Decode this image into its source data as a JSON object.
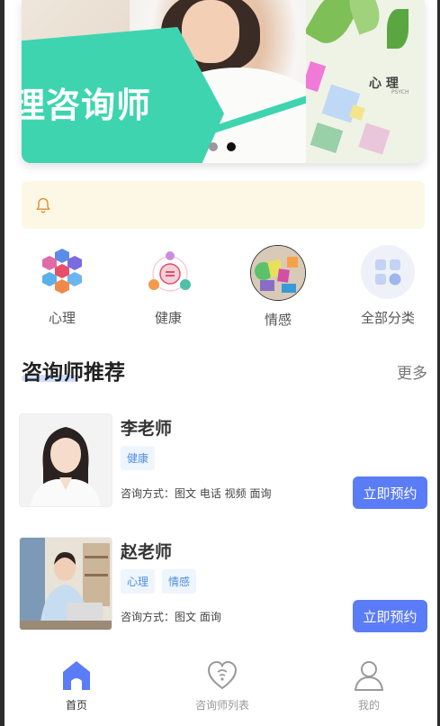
{
  "banner": {
    "slide1_caption": "理咨询师",
    "slide2_caption": "心 理",
    "slide2_sub": "PSYCH",
    "active_index": 1
  },
  "categories": [
    {
      "label": "心理",
      "icon": "psychology-hexagons-icon"
    },
    {
      "label": "健康",
      "icon": "health-diagram-icon"
    },
    {
      "label": "情感",
      "icon": "emotion-photo-icon"
    },
    {
      "label": "全部分类",
      "icon": "grid-apps-icon"
    }
  ],
  "section": {
    "title": "咨询师推荐",
    "more": "更多"
  },
  "counselors": [
    {
      "name": "李老师",
      "tags": [
        "健康"
      ],
      "method": "咨询方式：图文 电话 视频 面询",
      "button": "立即预约"
    },
    {
      "name": "赵老师",
      "tags": [
        "心理",
        "情感"
      ],
      "method": "咨询方式：图文 面询",
      "button": "立即预约"
    }
  ],
  "tabbar": {
    "items": [
      {
        "label": "首页",
        "icon": "home-icon",
        "active": true
      },
      {
        "label": "咨询师列表",
        "icon": "counselor-list-icon",
        "active": false
      },
      {
        "label": "我的",
        "icon": "user-icon",
        "active": false
      }
    ]
  },
  "colors": {
    "accent": "#5a7cf6",
    "tag_text": "#4f8fe0",
    "notice_bg": "#fdf8e6",
    "banner_teal": "#3fd4b0"
  }
}
